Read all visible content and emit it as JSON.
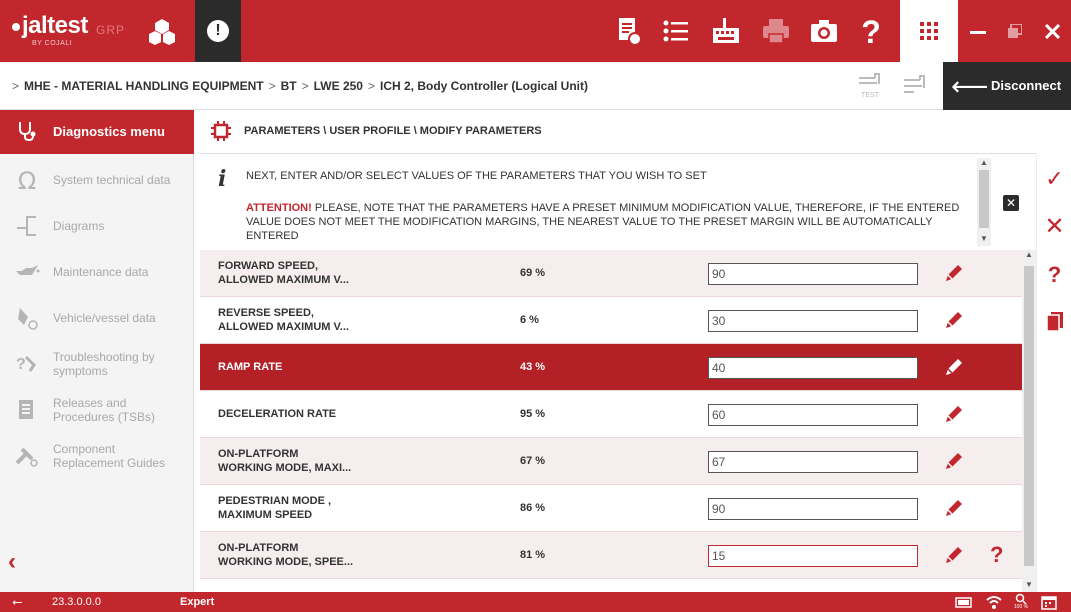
{
  "brand": {
    "logo": "jaltest",
    "logo_sub": "BY COJALI",
    "grp": "GRP"
  },
  "colors": {
    "accent": "#c1272d",
    "dark": "#2b2b2b",
    "row_tint": "#f6eeee",
    "selected_row": "#b32025"
  },
  "toolbar_icons": [
    "report-icon",
    "list-icon",
    "keyboard-icon",
    "printer-icon",
    "camera-icon",
    "help-icon",
    "apps-grid-icon",
    "minimize-icon",
    "restore-icon",
    "close-icon"
  ],
  "breadcrumb": {
    "items": [
      "MHE - MATERIAL HANDLING EQUIPMENT",
      "BT",
      "LWE 250",
      "ICH 2, Body Controller (Logical Unit)"
    ],
    "prefix": ">",
    "sep": ">"
  },
  "connection": {
    "test_label": "TEST",
    "disconnect_label": "Disconnect"
  },
  "sidebar": {
    "header": "Diagnostics menu",
    "items": [
      {
        "label": "System technical data",
        "icon": "ohm-icon"
      },
      {
        "label": "Diagrams",
        "icon": "diagram-icon"
      },
      {
        "label": "Maintenance data",
        "icon": "oil-can-icon"
      },
      {
        "label": "Vehicle/vessel data",
        "icon": "vehicle-data-icon"
      },
      {
        "label": "Troubleshooting by symptoms",
        "icon": "troubleshooting-icon"
      },
      {
        "label": "Releases and Procedures (TSBs)",
        "icon": "tsb-icon"
      },
      {
        "label": "Component Replacement Guides",
        "icon": "replacement-icon"
      }
    ]
  },
  "main": {
    "title": "PARAMETERS \\ USER PROFILE \\ MODIFY PARAMETERS",
    "info_line1": "NEXT, ENTER AND/OR SELECT VALUES OF THE PARAMETERS THAT YOU WISH TO SET",
    "attention_label": "ATTENTION!",
    "attention_text": " PLEASE, NOTE THAT THE PARAMETERS HAVE A PRESET MINIMUM MODIFICATION VALUE, THEREFORE, IF THE ENTERED VALUE DOES NOT MEET THE MODIFICATION MARGINS, THE NEAREST VALUE TO THE PRESET MARGIN WILL BE AUTOMATICALLY ENTERED"
  },
  "parameters": [
    {
      "name_l1": "FORWARD SPEED,",
      "name_l2": "ALLOWED MAXIMUM V...",
      "percent": "69 %",
      "value": "90",
      "selected": false,
      "error": false
    },
    {
      "name_l1": "REVERSE SPEED,",
      "name_l2": "ALLOWED MAXIMUM V...",
      "percent": "6 %",
      "value": "30",
      "selected": false,
      "error": false
    },
    {
      "name_l1": "RAMP RATE",
      "name_l2": "",
      "percent": "43 %",
      "value": "40",
      "selected": true,
      "error": false
    },
    {
      "name_l1": "DECELERATION RATE",
      "name_l2": "",
      "percent": "95 %",
      "value": "60",
      "selected": false,
      "error": false
    },
    {
      "name_l1": "ON-PLATFORM",
      "name_l2": "WORKING MODE, MAXI...",
      "percent": "67 %",
      "value": "67",
      "selected": false,
      "error": false
    },
    {
      "name_l1": "PEDESTRIAN MODE ,",
      "name_l2": "MAXIMUM SPEED",
      "percent": "86 %",
      "value": "90",
      "selected": false,
      "error": false
    },
    {
      "name_l1": "ON-PLATFORM",
      "name_l2": "WORKING MODE, SPEE...",
      "percent": "81 %",
      "value": "15",
      "selected": false,
      "error": true,
      "help": "?"
    }
  ],
  "right_actions": [
    {
      "name": "confirm-button",
      "glyph": "✓"
    },
    {
      "name": "cancel-button",
      "glyph": "✕"
    },
    {
      "name": "help-button",
      "glyph": "?"
    },
    {
      "name": "copy-button",
      "glyph": ""
    }
  ],
  "status": {
    "version": "23.3.0.0.0",
    "mode": "Expert",
    "zoom_label": "100 %"
  }
}
